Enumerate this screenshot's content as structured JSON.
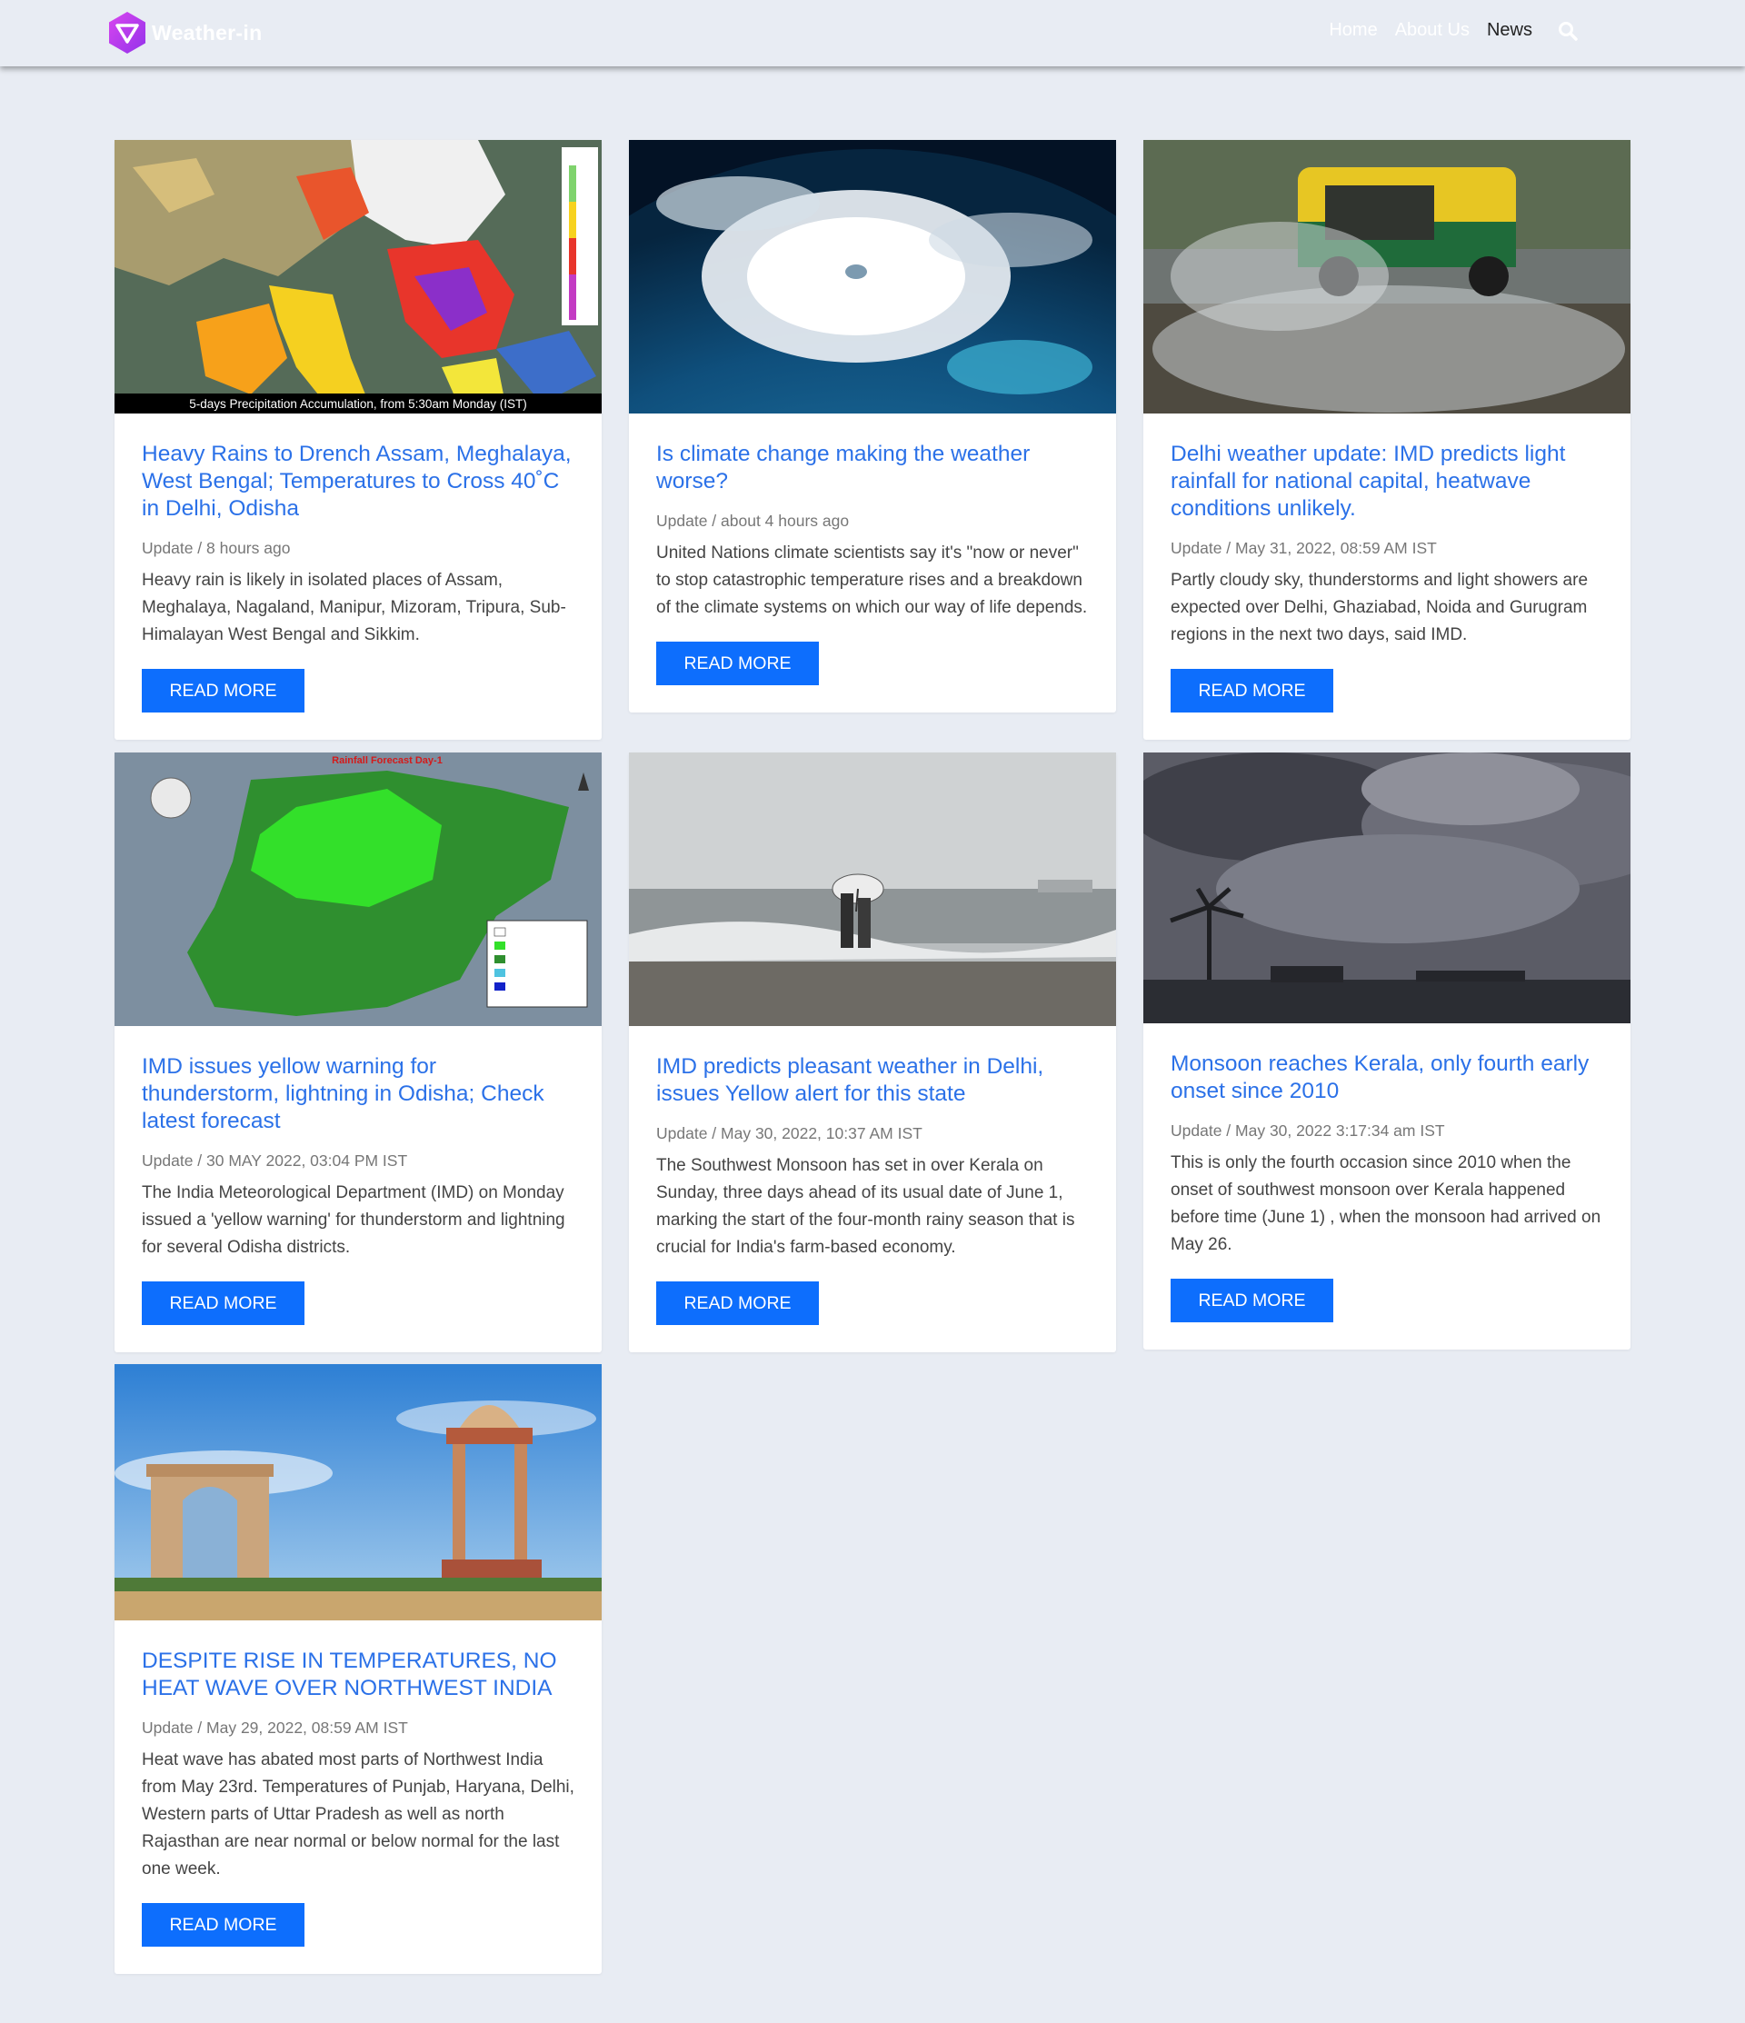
{
  "header": {
    "brand": "Weather-in",
    "nav": [
      {
        "label": "Home"
      },
      {
        "label": "About Us"
      },
      {
        "label": "News"
      }
    ]
  },
  "colors": {
    "accent": "#2b71e8",
    "button": "#0d6efd",
    "background": "#e8ecf3",
    "logo": "#c026d3"
  },
  "cards": [
    {
      "title": "Heavy Rains to Drench Assam, Meghalaya, West Bengal; Temperatures to Cross 40˚C in Delhi, Odisha",
      "meta": "Update / 8 hours ago",
      "text": "Heavy rain is likely in isolated places of Assam, Meghalaya, Nagaland, Manipur, Mizoram, Tripura, Sub-Himalayan West Bengal and Sikkim.",
      "button": "READ MORE",
      "image_caption": "5-days Precipitation Accumulation, from 5:30am Monday (IST)"
    },
    {
      "title": "Is climate change making the weather worse?",
      "meta": "Update / about 4 hours ago",
      "text": "United Nations climate scientists say it's \"now or never\" to stop catastrophic temperature rises and a breakdown of the climate systems on which our way of life depends.",
      "button": "READ MORE"
    },
    {
      "title": "Delhi weather update: IMD predicts light rainfall for national capital, heatwave conditions unlikely.",
      "meta": "Update / May 31, 2022, 08:59 AM IST",
      "text": "Partly cloudy sky, thunderstorms and light showers are expected over Delhi, Ghaziabad, Noida and Gurugram regions in the next two days, said IMD.",
      "button": "READ MORE"
    },
    {
      "title": "IMD issues yellow warning for thunderstorm, lightning in Odisha; Check latest forecast",
      "meta": "Update / 30 MAY 2022, 03:04 PM IST",
      "text": "The India Meteorological Department (IMD) on Monday issued a 'yellow warning' for thunderstorm and lightning for several Odisha districts.",
      "button": "READ MORE",
      "image_caption": "Rainfall Forecast Day-1"
    },
    {
      "title": "IMD predicts pleasant weather in Delhi, issues Yellow alert for this state",
      "meta": "Update / May 30, 2022, 10:37 AM IST",
      "text": "The Southwest Monsoon has set in over Kerala on Sunday, three days ahead of its usual date of June 1, marking the start of the four-month rainy season that is crucial for India's farm-based economy.",
      "button": "READ MORE"
    },
    {
      "title": "Monsoon reaches Kerala, only fourth early onset since 2010",
      "meta": "Update / May 30, 2022 3:17:34 am IST",
      "text": "This is only the fourth occasion since 2010 when the onset of southwest monsoon over Kerala happened before time (June 1) , when the monsoon had arrived on May 26.",
      "button": "READ MORE"
    },
    {
      "title": "DESPITE RISE IN TEMPERATURES, NO HEAT WAVE OVER NORTHWEST INDIA",
      "meta": "Update / May 29, 2022, 08:59 AM IST",
      "text": "Heat wave has abated most parts of Northwest India from May 23rd. Temperatures of Punjab, Haryana, Delhi, Western parts of Uttar Pradesh as well as north Rajasthan are near normal or below normal for the last one week.",
      "button": "READ MORE"
    }
  ]
}
